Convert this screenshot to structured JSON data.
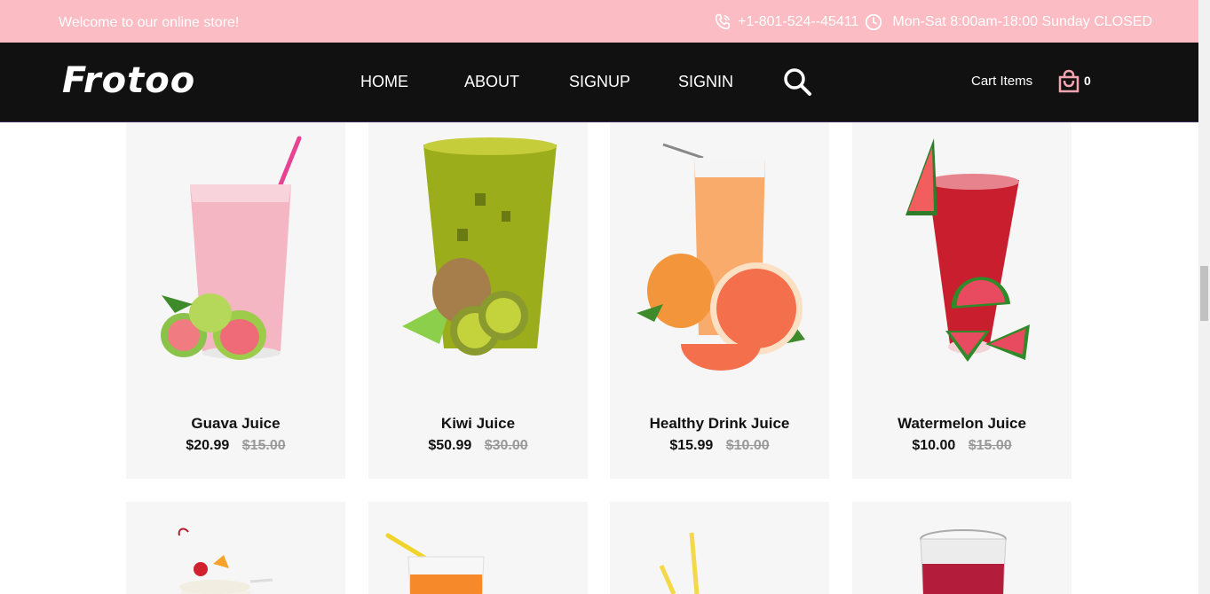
{
  "topbar": {
    "welcome": "Welcome to our online store!",
    "phone": "+1-801-524--45411",
    "hours": "Mon-Sat 8:00am-18:00 Sunday CLOSED"
  },
  "nav": {
    "logo": "Frotoo",
    "links": [
      "HOME",
      "ABOUT",
      "SIGNUP",
      "SIGNIN"
    ],
    "cart_label": "Cart Items",
    "cart_count": "0"
  },
  "products": [
    {
      "name": "Guava Juice",
      "price": "$20.99",
      "old_price": "$15.00"
    },
    {
      "name": "Kiwi Juice",
      "price": "$50.99",
      "old_price": "$30.00"
    },
    {
      "name": "Healthy Drink Juice",
      "price": "$15.99",
      "old_price": "$10.00"
    },
    {
      "name": "Watermelon Juice",
      "price": "$10.00",
      "old_price": "$15.00"
    }
  ],
  "colors": {
    "topbar_bg": "#fbbcc3",
    "navbar_bg": "#111111",
    "accent": "#f4a5b0",
    "card_bg": "#f6f6f6"
  }
}
